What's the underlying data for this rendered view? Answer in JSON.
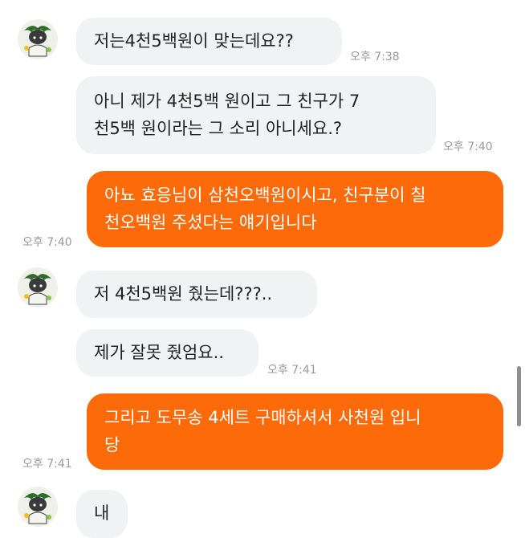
{
  "colors": {
    "incoming_bubble": "#f1f2f4",
    "outgoing_bubble": "#fd6a0a",
    "timestamp": "#9a9a9a"
  },
  "messages": [
    {
      "direction": "received",
      "text": "저는4천5백원이 맞는데요??",
      "time": "오후 7:38",
      "avatar": "character-avatar"
    },
    {
      "direction": "received",
      "text": "아니 제가 4천5백 원이고 그 친구가 7\n천5백 원이라는 그 소리 아니세요.?",
      "time": "오후 7:40"
    },
    {
      "direction": "sent",
      "text": "아뇨 효응님이 삼천오백원이시고, 친구분이 칠\n천오백원 주셨다는 얘기입니다",
      "time": "오후 7:40"
    },
    {
      "direction": "received",
      "text": "저 4천5백원 줬는데???..",
      "avatar": "character-avatar"
    },
    {
      "direction": "received",
      "text": "제가 잘못 줬엄요..",
      "time": "오후 7:41"
    },
    {
      "direction": "sent",
      "text": "그리고 도무송 4세트 구매하셔서 사천원 입니\n당",
      "time": "오후 7:41"
    },
    {
      "direction": "received",
      "text": "내",
      "avatar": "character-avatar"
    }
  ]
}
